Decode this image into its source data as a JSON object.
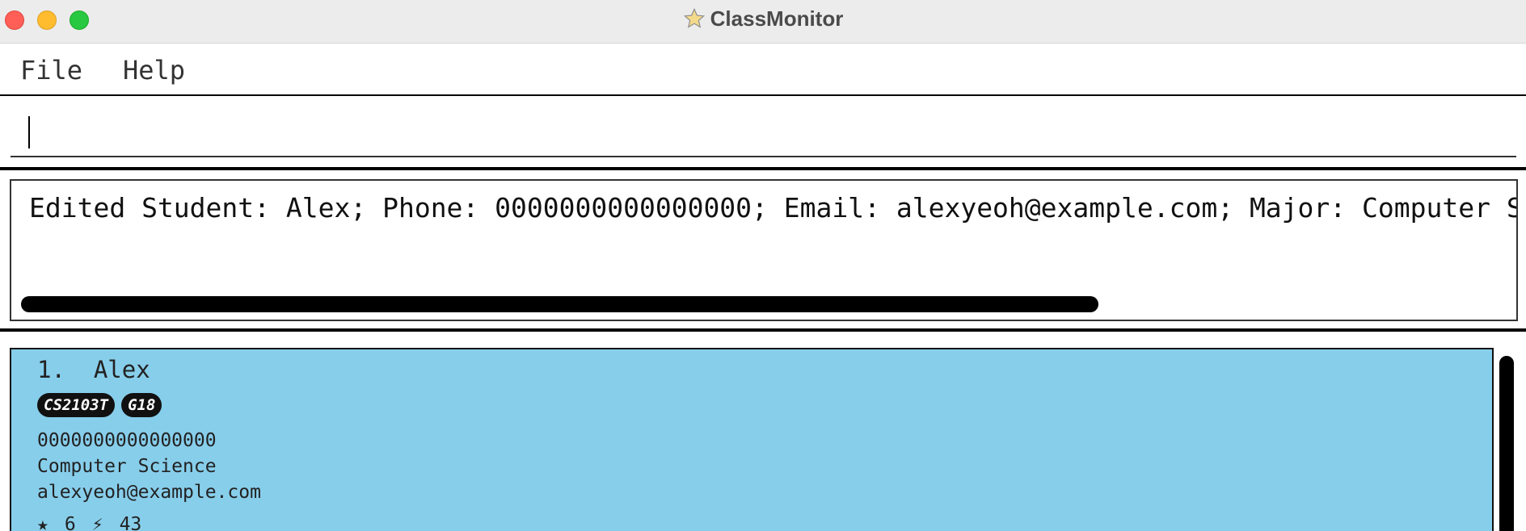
{
  "window": {
    "title": "ClassMonitor",
    "icon": "star-icon"
  },
  "menu": {
    "items": [
      "File",
      "Help"
    ]
  },
  "command": {
    "value": ""
  },
  "result": {
    "text": "Edited Student: Alex; Phone: 0000000000000000; Email: alexyeoh@example.com; Major: Computer Science"
  },
  "students": [
    {
      "index_name": "1.  Alex",
      "tags": [
        "CS2103T",
        "G18"
      ],
      "phone": "0000000000000000",
      "major": "Computer Science",
      "email": "alexyeoh@example.com",
      "star_count": "6",
      "participation": "43"
    }
  ],
  "colors": {
    "card_bg": "#87ceeb",
    "titlebar_bg": "#ececec"
  }
}
